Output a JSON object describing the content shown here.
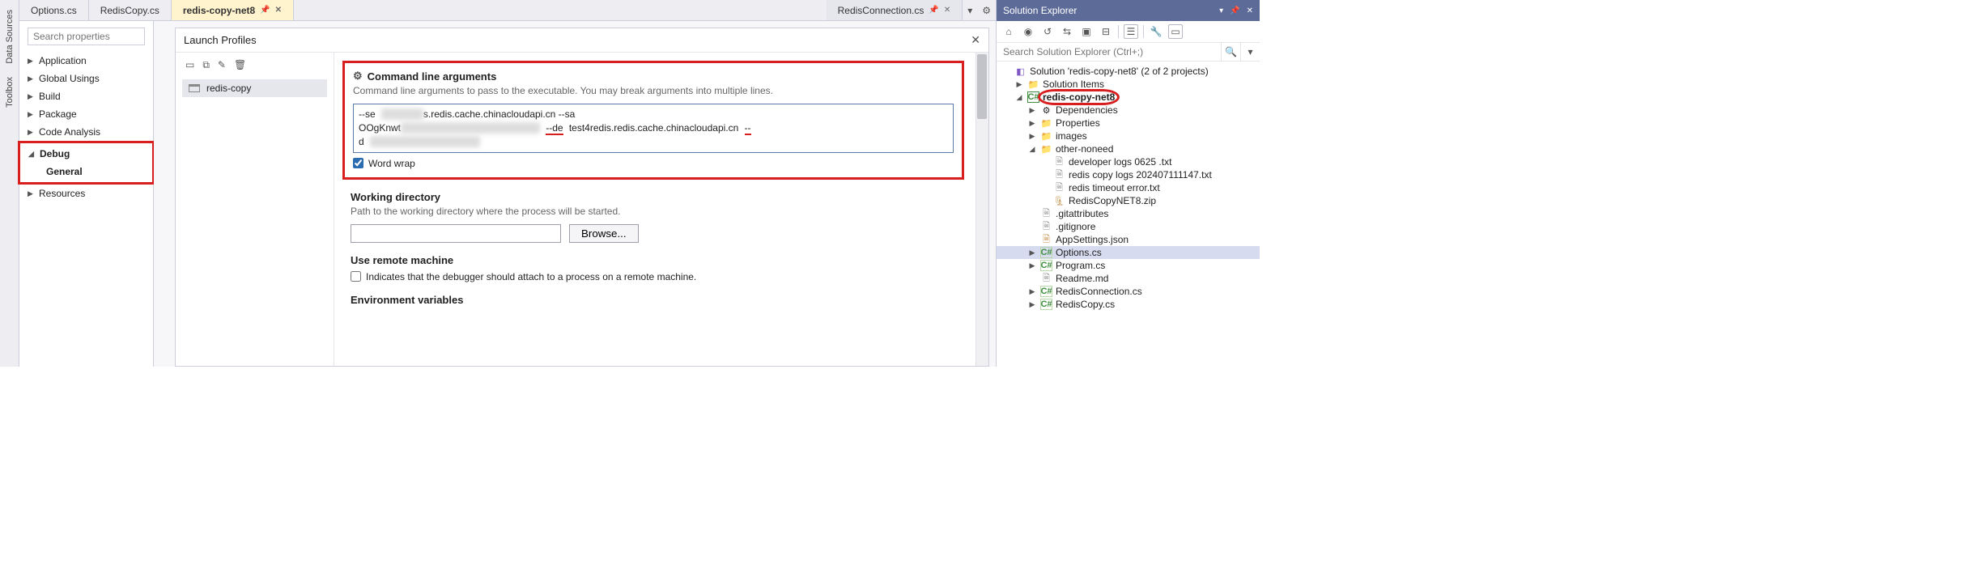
{
  "toolStrip": {
    "tabs": [
      "Data Sources",
      "Toolbox"
    ]
  },
  "editorTabs": {
    "left": [
      {
        "label": "Options.cs"
      },
      {
        "label": "RedisCopy.cs"
      },
      {
        "label": "redis-copy-net8",
        "active": true,
        "pinned": true
      }
    ],
    "right": [
      {
        "label": "RedisConnection.cs",
        "pinned": true
      }
    ]
  },
  "projNav": {
    "searchPlaceholder": "Search properties",
    "items": {
      "application": "Application",
      "globalUsings": "Global Usings",
      "build": "Build",
      "package": "Package",
      "codeAnalysis": "Code Analysis",
      "debug": "Debug",
      "general": "General",
      "resources": "Resources"
    }
  },
  "dialog": {
    "title": "Launch Profiles",
    "profile": "redis-copy",
    "cmdArgs": {
      "heading": "Command line arguments",
      "desc": "Command line arguments to pass to the executable. You may break arguments into multiple lines.",
      "text_parts": {
        "p1": "--se",
        "blur1": "xxxxxxxx",
        "p2": "s.redis.cache.chinacloudapi.cn --sa",
        "p3": "OOgKnwt",
        "blur2": "xxxxxxxxxxxxxxxxxxxxxxxxxxxx",
        "p4": "--de",
        "p5": "test4redis.redis.cache.chinacloudapi.cn",
        "p6": "--",
        "p7": "d",
        "blur3": "xxxxxxxxxxxxxxxxxxxxxx"
      },
      "wordWrapLabel": "Word wrap",
      "wordWrapChecked": true
    },
    "workingDir": {
      "heading": "Working directory",
      "desc": "Path to the working directory where the process will be started.",
      "value": "",
      "browse": "Browse..."
    },
    "remote": {
      "heading": "Use remote machine",
      "desc": "Indicates that the debugger should attach to a process on a remote machine.",
      "checked": false
    },
    "env": {
      "heading": "Environment variables"
    }
  },
  "solExplorer": {
    "title": "Solution Explorer",
    "searchPlaceholder": "Search Solution Explorer (Ctrl+;)",
    "solution": "Solution 'redis-copy-net8' (2 of 2 projects)",
    "nodes": {
      "solutionItems": "Solution Items",
      "proj": "redis-copy-net8",
      "dependencies": "Dependencies",
      "properties": "Properties",
      "images": "images",
      "otherNoneed": "other-noneed",
      "devLogs": "developer logs 0625 .txt",
      "redisCopyLogs": "redis copy logs 202407111147.txt",
      "redisTimeout": "redis timeout error.txt",
      "redisCopyZip": "RedisCopyNET8.zip",
      "gitattr": ".gitattributes",
      "gitignore": ".gitignore",
      "appsettings": "AppSettings.json",
      "optionsCs": "Options.cs",
      "programCs": "Program.cs",
      "readme": "Readme.md",
      "redisConn": "RedisConnection.cs",
      "redisCopyCs": "RedisCopy.cs"
    }
  }
}
